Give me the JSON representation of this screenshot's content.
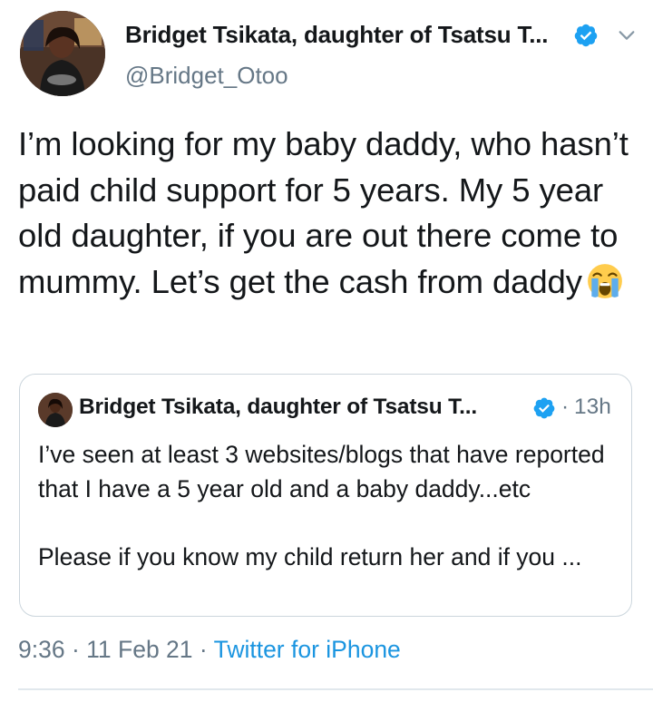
{
  "author": {
    "name": "Bridget Tsikata, daughter of Tsatsu T...",
    "handle": "@Bridget_Otoo"
  },
  "tweet": {
    "text": "I’m looking for my baby daddy, who hasn’t paid child support for 5 years. My 5 year old daughter, if you are out there come to mummy. Let’s get the cash from daddy",
    "emoji": "loudly-crying-face-emoji"
  },
  "quoted_tweet": {
    "name": "Bridget Tsikata, daughter of Tsatsu T...",
    "separator": "·",
    "time": "13h",
    "text": "I’ve seen at least 3 websites/blogs that have reported that I have a 5 year old and a baby daddy...etc\n\nPlease if you know my child return her and if you ..."
  },
  "meta": {
    "time": "9:36",
    "sep1": " · ",
    "date": "11 Feb 21",
    "sep2": " · ",
    "source": "Twitter for iPhone"
  },
  "colors": {
    "verified": "#1da1f2",
    "link": "#1b95e0",
    "secondary_text": "#657786",
    "border": "#ccd6dd"
  },
  "icons": {
    "verified": "verified-badge-icon",
    "menu": "chevron-down-icon"
  }
}
